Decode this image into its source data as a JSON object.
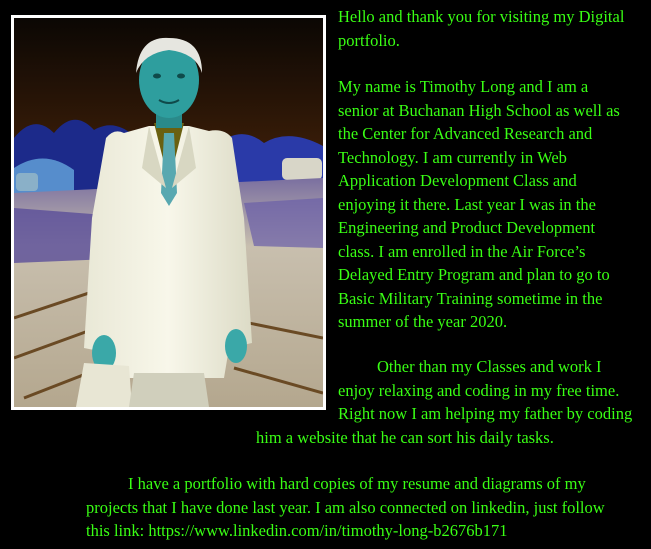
{
  "colors": {
    "background": "#000000",
    "text": "#39ff14",
    "frame": "#ffffff"
  },
  "photo": {
    "description_icon": "portrait-photo"
  },
  "intro": {
    "lines": [
      "Hello and thank you for visiting my Digital",
      "portfolio."
    ]
  },
  "bio": {
    "lines": [
      "My name is Timothy Long and I am a",
      "senior at Buchanan High School as well as",
      "the Center for Advanced Research and",
      "Technology. I am currently in Web",
      "Application Development Class and",
      "enjoying it there. Last year I was in the",
      "Engineering and Product Development",
      "class. I am enrolled in the Air Force’s",
      "Delayed Entry Program and plan to go to",
      "Basic Military Training  sometime in the",
      "summer of the year 2020."
    ]
  },
  "hobbies": {
    "lines": [
      "Other than my Classes and work I",
      "enjoy relaxing and coding in my free time.",
      "Right now I am helping my father by coding",
      "him a website that he can sort his daily tasks."
    ]
  },
  "portfolio": {
    "lines": [
      "I have a portfolio with hard copies of my resume and diagrams of my",
      "projects that I have done last year. I am also connected on linkedin, just follow",
      "this link: https://www.linkedin.com/in/timothy-long-b2676b171"
    ]
  }
}
